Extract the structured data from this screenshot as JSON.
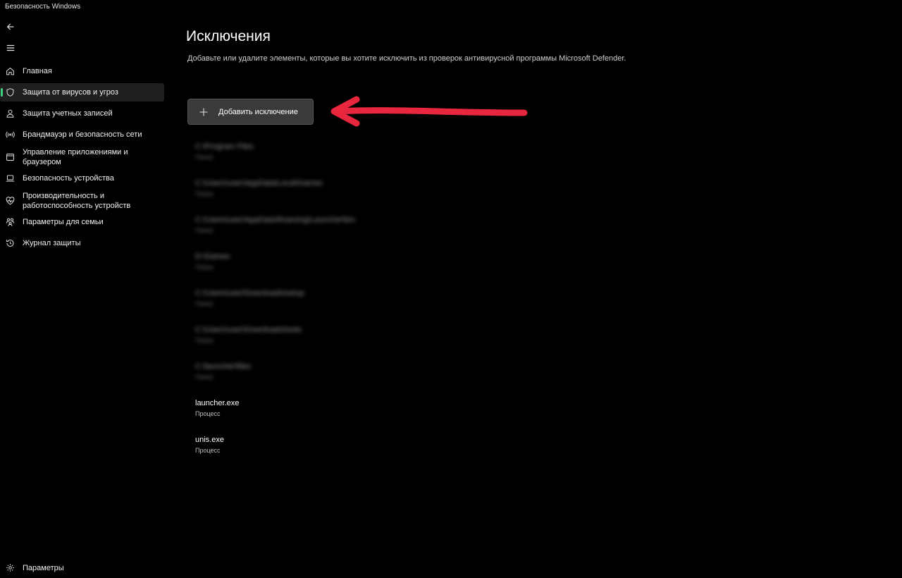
{
  "window": {
    "title": "Безопасность Windows"
  },
  "sidebar": {
    "back_icon": "back-arrow-icon",
    "menu_icon": "hamburger-menu-icon",
    "items": [
      {
        "label": "Главная",
        "icon": "home-icon",
        "active": false
      },
      {
        "label": "Защита от вирусов и угроз",
        "icon": "shield-icon",
        "active": true
      },
      {
        "label": "Защита учетных записей",
        "icon": "person-icon",
        "active": false
      },
      {
        "label": "Брандмауэр и безопасность сети",
        "icon": "wireless-signal-icon",
        "active": false
      },
      {
        "label": "Управление приложениями и браузером",
        "icon": "app-window-icon",
        "active": false
      },
      {
        "label": "Безопасность устройства",
        "icon": "laptop-icon",
        "active": false
      },
      {
        "label": "Производительность и работоспособность устройств",
        "icon": "heart-pulse-icon",
        "active": false
      },
      {
        "label": "Параметры для семьи",
        "icon": "family-icon",
        "active": false
      },
      {
        "label": "Журнал защиты",
        "icon": "history-icon",
        "active": false
      }
    ],
    "settings": {
      "label": "Параметры",
      "icon": "gear-icon"
    }
  },
  "main": {
    "title": "Исключения",
    "description": "Добавьте или удалите элементы, которые вы хотите исключить из проверок антивирусной программы Microsoft Defender.",
    "add_button": {
      "label": "Добавить исключение",
      "icon": "plus-icon"
    },
    "annotation": {
      "color": "#e8263d",
      "icon": "red-arrow-pointer"
    },
    "accent_color": "#3fd07f",
    "exclusions": [
      {
        "name": "C:\\Program Files",
        "type": "Папка",
        "redacted": true
      },
      {
        "name": "C:\\Users\\user\\AppData\\Local\\Games",
        "type": "Папка",
        "redacted": true
      },
      {
        "name": "C:\\Users\\user\\AppData\\Roaming\\Launcher\\bin",
        "type": "Папка",
        "redacted": true
      },
      {
        "name": "D:\\Games",
        "type": "Папка",
        "redacted": true
      },
      {
        "name": "C:\\Users\\user\\Downloads\\setup",
        "type": "Папка",
        "redacted": true
      },
      {
        "name": "C:\\Users\\user\\Downloads\\tools",
        "type": "Папка",
        "redacted": true
      },
      {
        "name": "C:\\launcher\\files",
        "type": "Папка",
        "redacted": true
      },
      {
        "name": "launcher.exe",
        "type": "Процесс",
        "redacted": false
      },
      {
        "name": "unis.exe",
        "type": "Процесс",
        "redacted": false
      }
    ]
  }
}
